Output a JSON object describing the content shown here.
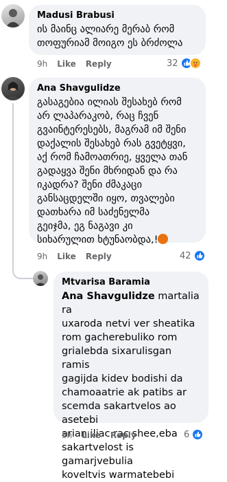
{
  "comments": [
    {
      "author": "Madusi Brabusi",
      "text": "ის მაინც ალიარე მერაბ რომ\nთოფურიამ მოიგო ეს ბრძოლა",
      "time": "9h",
      "like_label": "Like",
      "reply_label": "Reply",
      "reaction_count": "32",
      "reactions": [
        "like-icon",
        "care-icon"
      ]
    },
    {
      "author": "Ana Shavgulidze",
      "text": "გასაგებია ილიას შესახებ რომ\nარ ლაპარაკობ, რაც ჩვენ\nგვაინტერესებს, მაგრამ იმ შენი\nდაქალის შესახებ რას გვეტყვი,\nაქ რომ ჩამოათრიე, ყველა თან\nგადაყვა შენი მხრიდან და რა\nიკადრა? შენი ძმაკაცი\nგანსაცდელში იყო, თვალები\nდათხარა იმ საძენელმა\nგეიჯმა, ეგ ნაგავი კი\nსიხარულით ხტუნაობდა,!",
      "time": "9h",
      "like_label": "Like",
      "reply_label": "Reply",
      "reaction_count": "42",
      "reactions": [
        "like-icon"
      ],
      "trailing_emoji": "angry-emoji"
    }
  ],
  "reply": {
    "author": "Mtvarisa Baramia",
    "mention": "Ana Shavgulidze",
    "text": " martalia ra\nuxaroda netvi ver sheatika\nrom gacherebuliko rom\ngrialebda sixarulisgan ramis\ngagijda kidev bodishi da\nchamoaatrie ak patibs ar\nscemda sakartvelos ao asetebi\narian iliac rac shee,eba\nsakartvelost is gamarjvebulia\nkoveltvis warmatebebi",
    "time": "5h",
    "like_label": "Like",
    "reply_label": "Reply",
    "reaction_count": "6",
    "reactions": [
      "like-icon"
    ]
  },
  "colors": {
    "bubble": "#f0f2f5",
    "meta": "#65676b",
    "like_blue": "#1877f2",
    "angry_orange": "#e9710f",
    "care_yellow": "#f7b125"
  }
}
